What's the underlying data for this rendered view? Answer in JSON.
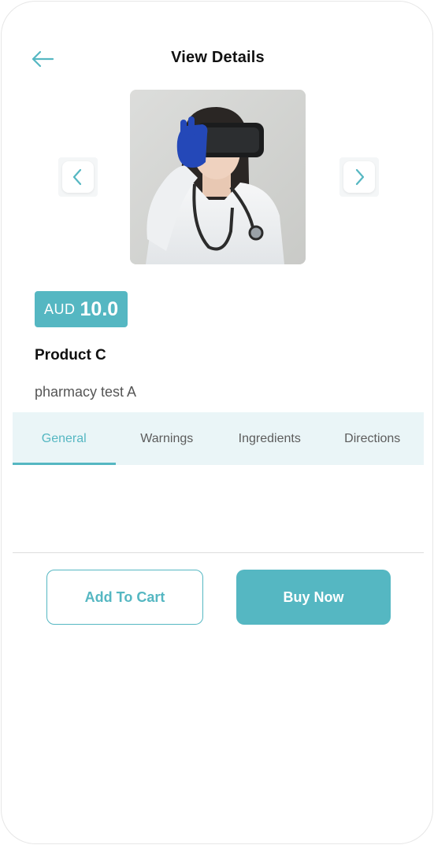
{
  "header": {
    "title": "View Details",
    "back_icon": "arrow-left-icon"
  },
  "carousel": {
    "prev_icon": "chevron-left-icon",
    "next_icon": "chevron-right-icon",
    "image_subject": "doctor-with-vr-headset-photo"
  },
  "product": {
    "currency": "AUD",
    "price": "10.0",
    "name": "Product C",
    "description": "pharmacy test A"
  },
  "tabs": [
    {
      "label": "General",
      "active": true
    },
    {
      "label": "Warnings",
      "active": false
    },
    {
      "label": "Ingredients",
      "active": false
    },
    {
      "label": "Directions",
      "active": false
    }
  ],
  "actions": {
    "add_to_cart": "Add To Cart",
    "buy_now": "Buy Now"
  },
  "colors": {
    "accent": "#55b7c2",
    "tab_bar_bg": "#eaf5f7",
    "text_primary": "#111111",
    "text_secondary": "#555555"
  }
}
